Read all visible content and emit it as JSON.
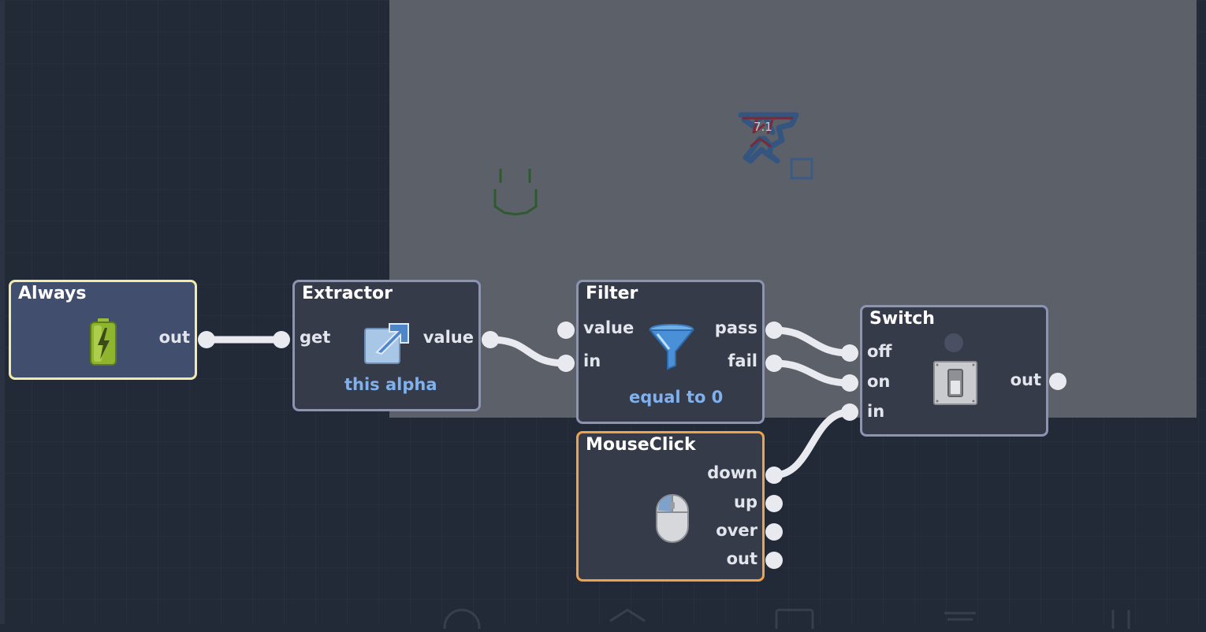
{
  "nodes": {
    "always": {
      "title": "Always",
      "ports": {
        "out": "out"
      }
    },
    "extractor": {
      "title": "Extractor",
      "ports": {
        "get": "get",
        "value": "value"
      },
      "param": "this alpha"
    },
    "filter": {
      "title": "Filter",
      "ports": {
        "value": "value",
        "in": "in",
        "pass": "pass",
        "fail": "fail"
      },
      "param": "equal to 0"
    },
    "switch": {
      "title": "Switch",
      "ports": {
        "off": "off",
        "on": "on",
        "in": "in",
        "out": "out"
      }
    },
    "mouseclick": {
      "title": "MouseClick",
      "ports": {
        "down": "down",
        "up": "up",
        "over": "over",
        "out": "out"
      }
    }
  },
  "colors": {
    "canvas_bg": "#222a38",
    "stage_bg": "#5b6069",
    "node_bg": "#363b49",
    "node_border": "#8c94b3",
    "always_border": "#f2eaa7",
    "mouseclick_border": "#f0a24a",
    "param_text": "#7eb1ee",
    "wire": "#e9eaf0"
  },
  "icons": {
    "always": "battery-icon",
    "extractor": "arrow-out-icon",
    "filter": "funnel-icon",
    "switch": "toggle-switch-icon",
    "mouseclick": "mouse-icon"
  }
}
